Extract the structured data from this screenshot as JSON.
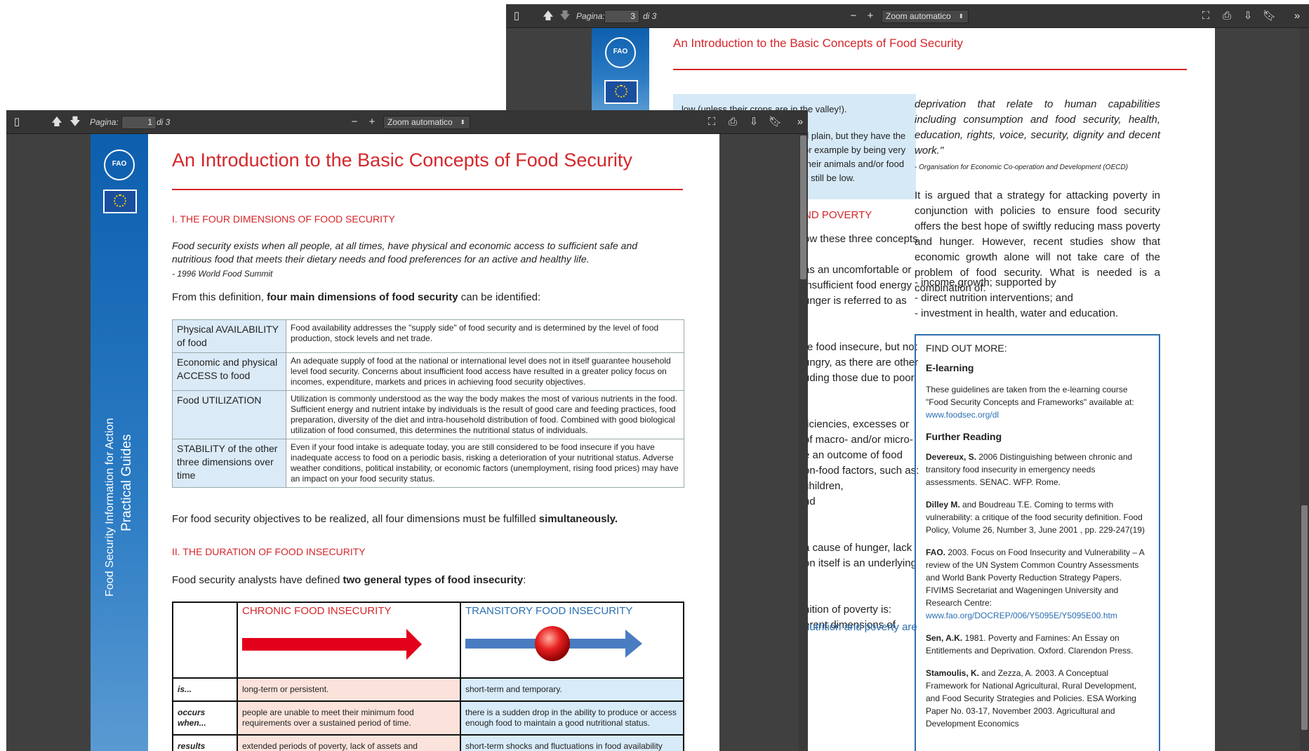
{
  "back_window": {
    "toolbar": {
      "page_label": "Pagina:",
      "page_value": "3",
      "page_total": "di 3",
      "zoom_label": "Zoom automatico",
      "minus": "−",
      "plus": "+"
    },
    "page": {
      "title": "An Introduction to the Basic Concepts of Food Security",
      "left_column": {
        "highlight_top": "low (unless their crops are in the valley!).",
        "highlight_lines": [
          "d plain, but they have the",
          "or example by being very",
          "their animals and/or food",
          "y still be low."
        ],
        "section_partial": "ND POVERTY",
        "lines": [
          "ow these three concepts",
          "",
          "as an uncomfortable or",
          "insufficient food energy",
          "unger is referred to as",
          "",
          "",
          "re food insecure, but not",
          "ungry, as there are other",
          "uding those due to poor",
          "",
          "",
          "ficiencies, excesses or",
          "of macro- and/or micro-",
          "e an outcome of food",
          "on-food factors, such as:",
          "children,",
          "nd",
          "",
          "",
          "a cause of hunger, lack",
          "on itself is an underlying",
          "",
          "",
          "nition of poverty is:",
          "erent dimensions of"
        ],
        "blue_line": "nutrition and poverty are"
      },
      "right_column": {
        "quote": "deprivation that relate to human capabilities including consumption and food security, health, education, rights, voice, security, dignity and decent work.\"",
        "quote_source": "- Organisation for Economic Co-operation and Development (OECD)",
        "para": "It is argued that a strategy for attacking poverty in conjunction with policies to ensure food security offers the best hope of swiftly reducing mass poverty and hunger. However, recent studies show that economic growth alone will not take care of the problem of food security. What is needed is a combination of:",
        "bullets": [
          "- income growth; supported by",
          "- direct nutrition interventions; and",
          "- investment in health, water and education."
        ],
        "findout": {
          "heading": "FIND OUT MORE:",
          "elearning_heading": "E-learning",
          "elearning_text": "These guidelines are taken from the e-learning course \"Food Security Concepts and Frameworks\" available at:",
          "elearning_link": "www.foodsec.org/dl",
          "reading_heading": "Further Reading",
          "refs": [
            {
              "bold": "Devereux, S.",
              "text": " 2006 Distinguishing between chronic and transitory food insecurity in emergency needs assessments. SENAC. WFP. Rome."
            },
            {
              "bold": "Dilley M.",
              "text": " and Boudreau T.E. Coming to terms with vulnerability: a critique of the food security definition. Food Policy, Volume 26, Number 3, June 2001 , pp. 229-247(19)"
            },
            {
              "bold": "FAO.",
              "text": " 2003. Focus on Food Insecurity and Vulnerability – A review of the UN System Common Country Assessments and World Bank Poverty Reduction Strategy Papers. FIVIMS Secretariat and Wageningen University and Research Centre:"
            },
            {
              "bold": "",
              "text": "www.fao.org/DOCREP/006/Y5095E/Y5095E00.htm"
            },
            {
              "bold": "Sen, A.K.",
              "text": " 1981. Poverty and Famines: An Essay on Entitlements and Deprivation. Oxford. Clarendon Press."
            },
            {
              "bold": "Stamoulis, K.",
              "text": " and Zezza, A. 2003. A Conceptual Framework for National Agricultural, Rural Development, and Food Security Strategies and Policies. ESA Working Paper No. 03-17, November 2003. Agricultural and Development Economics"
            }
          ]
        }
      }
    }
  },
  "front_window": {
    "toolbar": {
      "page_label": "Pagina:",
      "page_value": "1",
      "page_total": "di 3",
      "zoom_label": "Zoom automatico",
      "minus": "−",
      "plus": "+"
    },
    "page": {
      "band_text_1": "Food Security Information for Action",
      "band_text_2": "Practical Guides",
      "title": "An Introduction to the Basic Concepts of Food Security",
      "section1": "I. THE FOUR DIMENSIONS OF FOOD SECURITY",
      "quote": "Food security exists when all people, at all times, have physical and economic access to sufficient safe and nutritious food that meets their dietary needs and food preferences for an active and healthy life.",
      "quote_source": "- 1996 World Food Summit",
      "def_pre": "From this definition, ",
      "def_bold": "four main dimensions of food security",
      "def_post": " can be identified:",
      "dimensions": [
        {
          "name": "Physical AVAILABILITY of food",
          "desc": "Food availability addresses the \"supply side\" of food security and is determined by the level of food production, stock levels and net trade."
        },
        {
          "name": "Economic and physical ACCESS to food",
          "desc": "An adequate supply of food at the national or international level does not in itself guarantee household level food security. Concerns about insufficient food access have resulted in a greater policy focus on incomes, expenditure, markets and prices in achieving food security objectives."
        },
        {
          "name": "Food UTILIZATION",
          "desc": "Utilization is commonly understood as the way the body makes the most of various nutrients in the food. Sufficient energy and nutrient intake by individuals is the result of good care and feeding practices, food preparation, diversity of the diet and intra-household distribution of food. Combined with good biological utilization of food consumed, this determines the nutritional status of individuals."
        },
        {
          "name": "STABILITY of the other three dimensions over time",
          "desc": "Even if your food intake is adequate today, you are still considered to be food insecure if you have inadequate access to food on a periodic basis, risking a deterioration of your nutritional status. Adverse weather conditions, political instability, or economic factors (unemployment, rising food prices) may have an impact on your food security status."
        }
      ],
      "sim_pre": "For food security objectives to be realized, all four dimensions must be fulfilled ",
      "sim_bold": "simultaneously.",
      "section2": "II. THE DURATION OF FOOD INSECURITY",
      "dur_pre": "Food security analysts have defined ",
      "dur_bold": "two general types of food insecurity",
      "dur_post": ":",
      "duration_table": {
        "chronic_header": "CHRONIC FOOD INSECURITY",
        "transitory_header": "TRANSITORY FOOD INSECURITY",
        "rows": [
          {
            "label": "is...",
            "chronic": "long-term or persistent.",
            "transitory": "short-term and temporary."
          },
          {
            "label": "occurs when...",
            "chronic": "people are unable to meet their minimum food requirements over a sustained period of time.",
            "transitory": "there is a sudden drop in the ability to produce or access enough food to maintain a good nutritional status."
          },
          {
            "label": "results",
            "chronic": "extended periods of poverty, lack of assets and",
            "transitory": "short-term shocks and fluctuations in food availability"
          }
        ]
      }
    }
  },
  "colors": {
    "accent_red": "#d5262a",
    "fao_blue": "#0d5fae",
    "link_blue": "#2b6fb3",
    "toolbar": "#353535"
  }
}
